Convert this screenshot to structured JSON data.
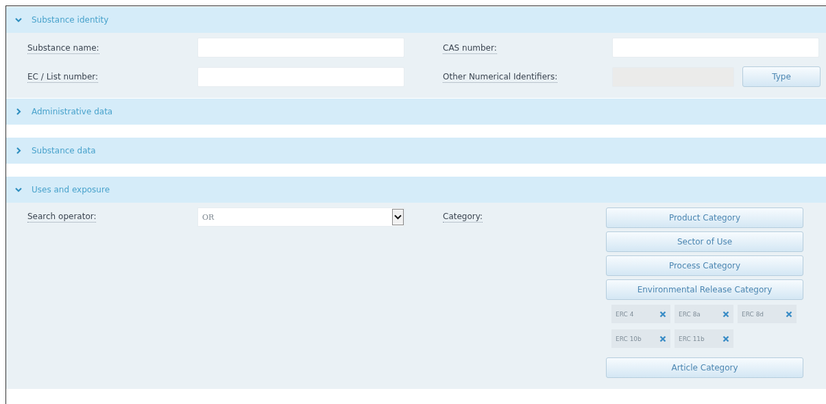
{
  "sections": [
    {
      "title": "Substance identity",
      "expanded": true,
      "kind": "fields",
      "fields": [
        {
          "label": "Substance name:",
          "disabled": false
        },
        {
          "label": "CAS number:",
          "disabled": false
        },
        {
          "label": "EC / List number:",
          "disabled": false
        },
        {
          "label": "Other Numerical Identifiers:",
          "disabled": true,
          "button": "Type"
        }
      ]
    },
    {
      "title": "Administrative data",
      "expanded": false
    },
    {
      "title": "Substance data",
      "expanded": false
    },
    {
      "title": "Uses and exposure",
      "expanded": true,
      "kind": "uses",
      "operator": {
        "label": "Search operator:",
        "value": "OR"
      },
      "category": {
        "label": "Category:",
        "items": [
          {
            "kind": "button",
            "label": "Product Category"
          },
          {
            "kind": "button",
            "label": "Sector of Use"
          },
          {
            "kind": "button",
            "label": "Process Category"
          },
          {
            "kind": "button",
            "label": "Environmental Release Category"
          },
          {
            "kind": "chips",
            "chips": [
              "ERC 4",
              "ERC 8a",
              "ERC 8d",
              "ERC 10b",
              "ERC 11b"
            ]
          },
          {
            "kind": "button",
            "label": "Article Category"
          }
        ]
      }
    }
  ]
}
